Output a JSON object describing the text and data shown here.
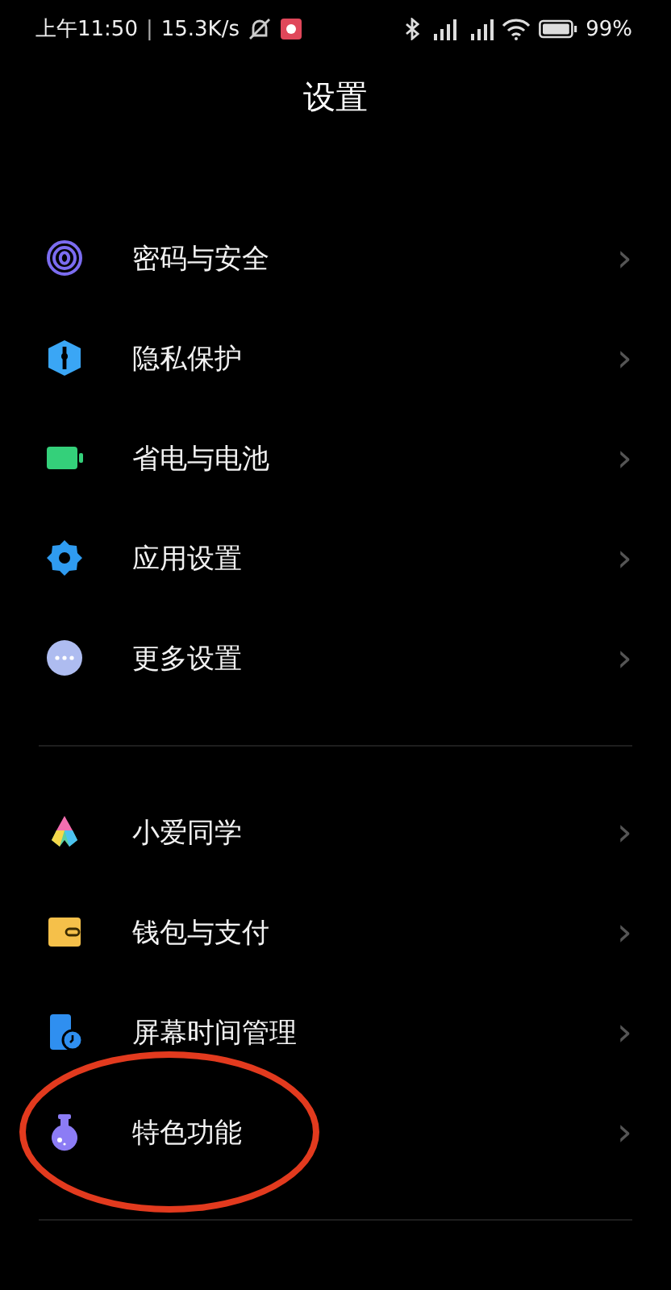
{
  "status_bar": {
    "time": "上午11:50",
    "separator": "|",
    "speed": "15.3K/s",
    "battery": "99%"
  },
  "header": {
    "title": "设置"
  },
  "sections": [
    {
      "items": [
        {
          "label": "密码与安全",
          "kind": "fingerprint",
          "chevron": "›"
        },
        {
          "label": "隐私保护",
          "kind": "shield",
          "chevron": "›"
        },
        {
          "label": "省电与电池",
          "kind": "battery",
          "chevron": "›"
        },
        {
          "label": "应用设置",
          "kind": "gear",
          "chevron": "›"
        },
        {
          "label": "更多设置",
          "kind": "dots",
          "chevron": "›"
        }
      ]
    },
    {
      "items": [
        {
          "label": "小爱同学",
          "kind": "assistant",
          "chevron": "›"
        },
        {
          "label": "钱包与支付",
          "kind": "wallet",
          "chevron": "›"
        },
        {
          "label": "屏幕时间管理",
          "kind": "screentime",
          "chevron": "›"
        },
        {
          "label": "特色功能",
          "kind": "flask",
          "chevron": "›",
          "circled": true
        }
      ]
    }
  ]
}
